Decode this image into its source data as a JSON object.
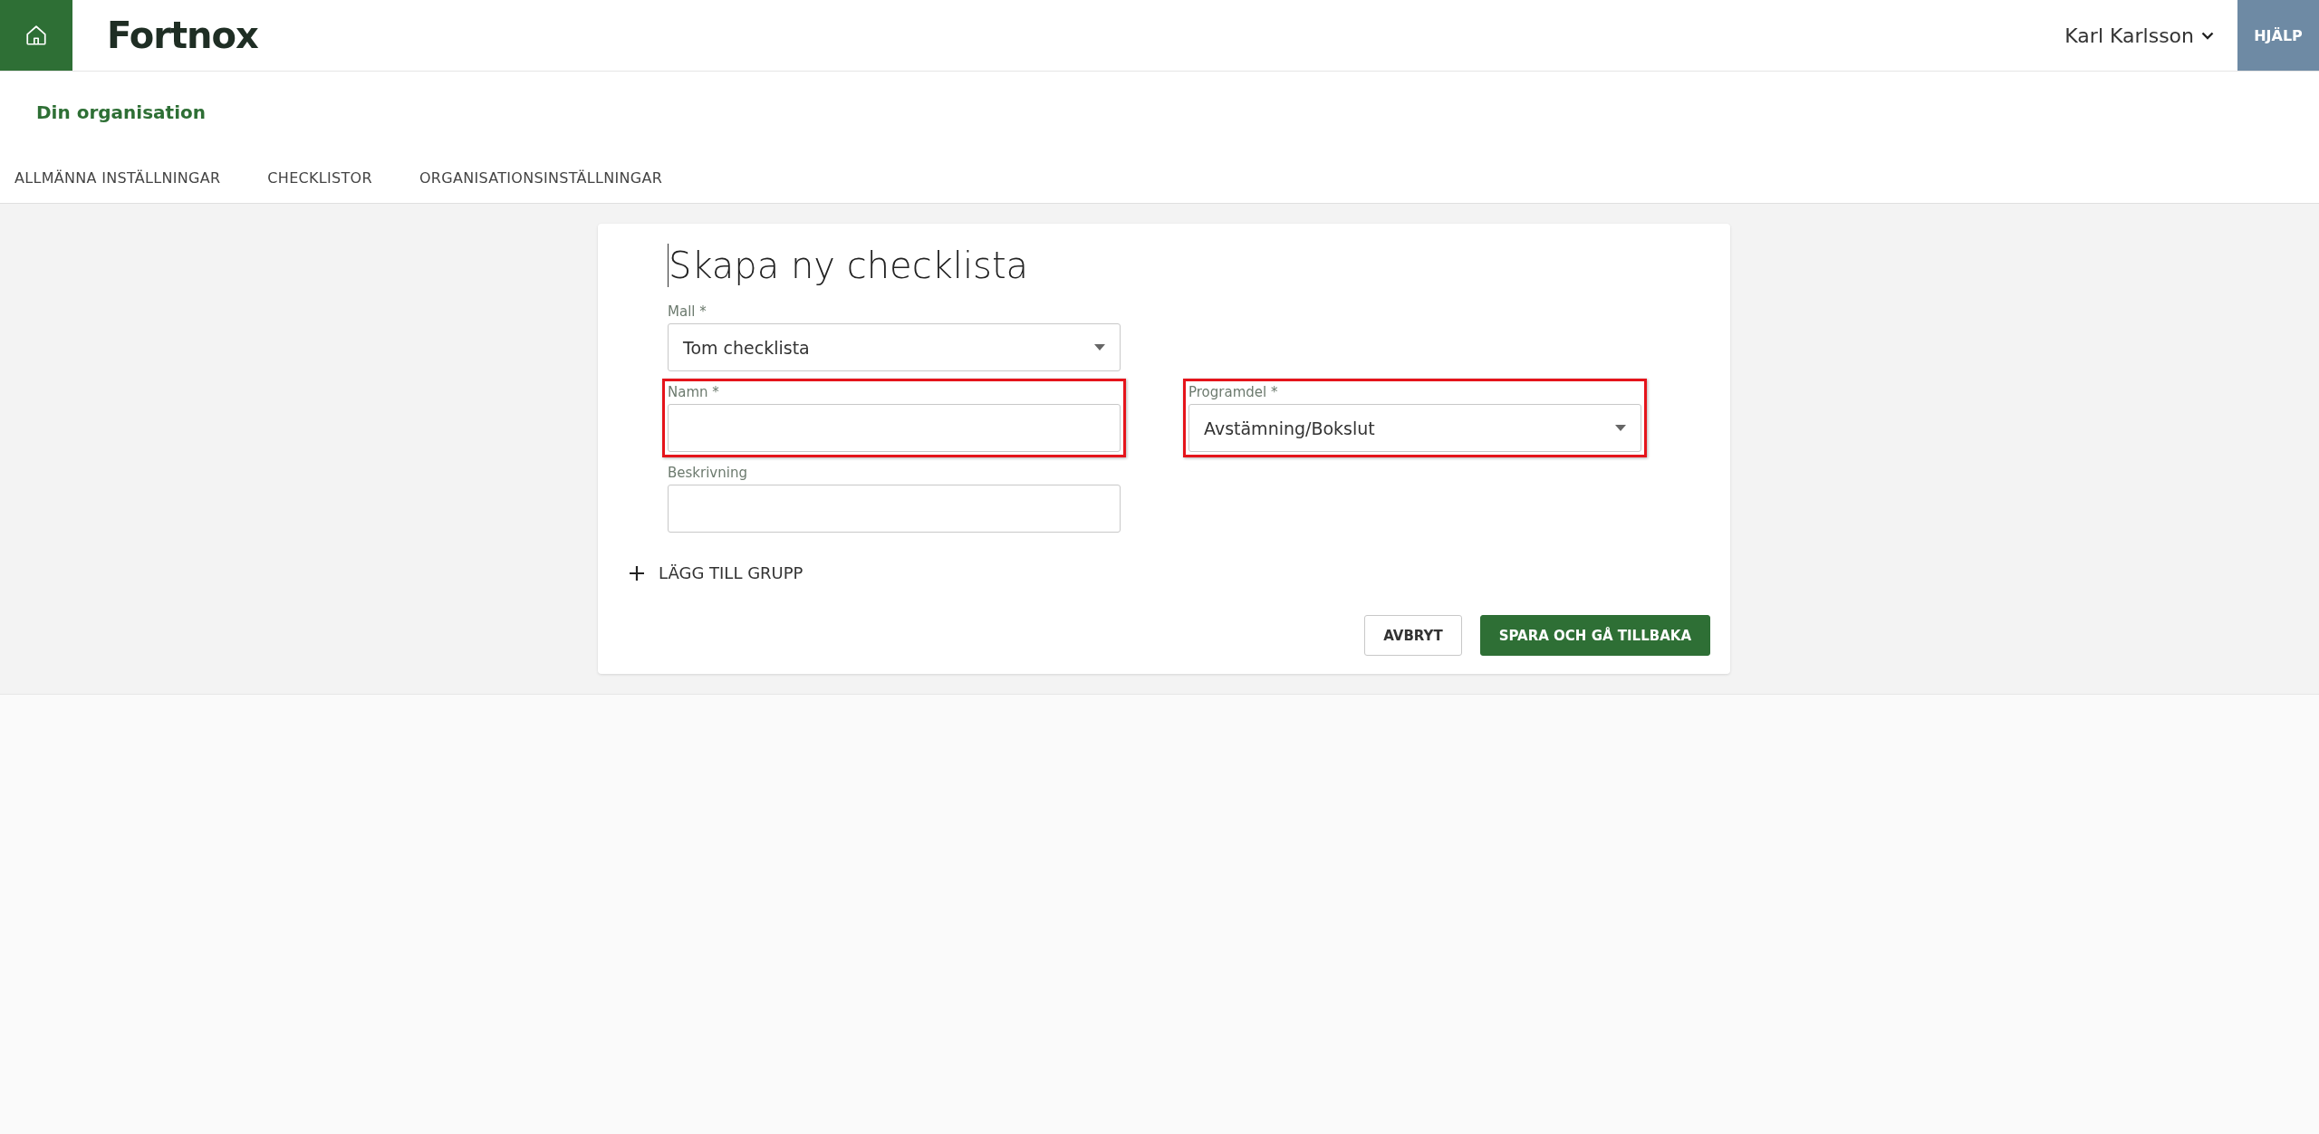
{
  "header": {
    "logo": "Fortnox",
    "user": "Karl Karlsson",
    "help": "HJÄLP"
  },
  "page_title": "Din organisation",
  "tabs": [
    {
      "label": "ALLMÄNNA INSTÄLLNINGAR"
    },
    {
      "label": "CHECKLISTOR"
    },
    {
      "label": "ORGANISATIONSINSTÄLLNINGAR"
    }
  ],
  "form": {
    "title": "Skapa ny checklista",
    "rows": [
      [
        {
          "kind": "select",
          "label": "Mall *",
          "value": "Tom checklista",
          "highlighted": false
        }
      ],
      [
        {
          "kind": "input",
          "label": "Namn *",
          "highlighted": true
        },
        {
          "kind": "select",
          "label": "Programdel *",
          "value": "Avstämning/Bokslut",
          "highlighted": true
        }
      ],
      [
        {
          "kind": "input",
          "label": "Beskrivning",
          "highlighted": false
        }
      ]
    ],
    "add_group": "LÄGG TILL GRUPP",
    "buttons": [
      {
        "label": "AVBRYT",
        "kind": "secondary"
      },
      {
        "label": "SPARA OCH GÅ TILLBAKA",
        "kind": "primary"
      }
    ]
  }
}
